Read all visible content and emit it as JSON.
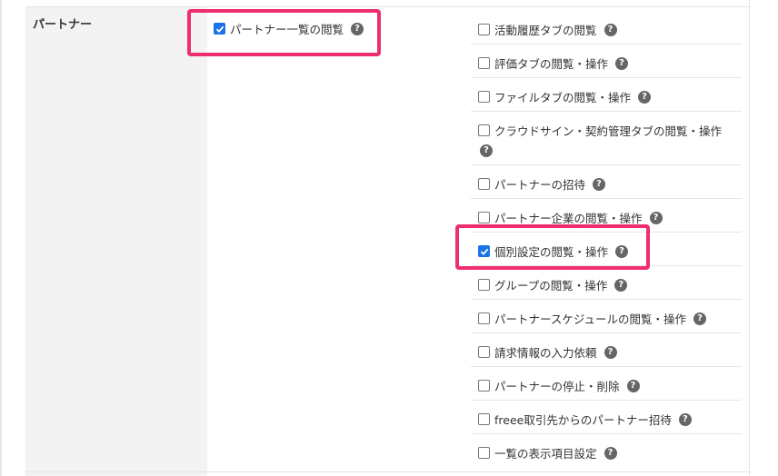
{
  "section": {
    "label": "パートナー"
  },
  "parent": {
    "label": "パートナー一覧の閲覧",
    "checked": true
  },
  "permissions": [
    {
      "label": "活動履歴タブの閲覧",
      "checked": false
    },
    {
      "label": "評価タブの閲覧・操作",
      "checked": false
    },
    {
      "label": "ファイルタブの閲覧・操作",
      "checked": false
    },
    {
      "label": "クラウドサイン・契約管理タブの閲覧・操作",
      "checked": false
    },
    {
      "label": "パートナーの招待",
      "checked": false
    },
    {
      "label": "パートナー企業の閲覧・操作",
      "checked": false
    },
    {
      "label": "個別設定の閲覧・操作",
      "checked": true
    },
    {
      "label": "グループの閲覧・操作",
      "checked": false
    },
    {
      "label": "パートナースケジュールの閲覧・操作",
      "checked": false
    },
    {
      "label": "請求情報の入力依頼",
      "checked": false
    },
    {
      "label": "パートナーの停止・削除",
      "checked": false
    },
    {
      "label": "freee取引先からのパートナー招待",
      "checked": false
    },
    {
      "label": "一覧の表示項目設定",
      "checked": false
    }
  ],
  "help_glyph": "?",
  "icons": {
    "help": "question-circle-icon",
    "check": "checkmark-icon"
  },
  "colors": {
    "highlight": "#ee2e70",
    "checkbox_checked": "#1a73e8",
    "label_bg": "#f3f3f3"
  }
}
